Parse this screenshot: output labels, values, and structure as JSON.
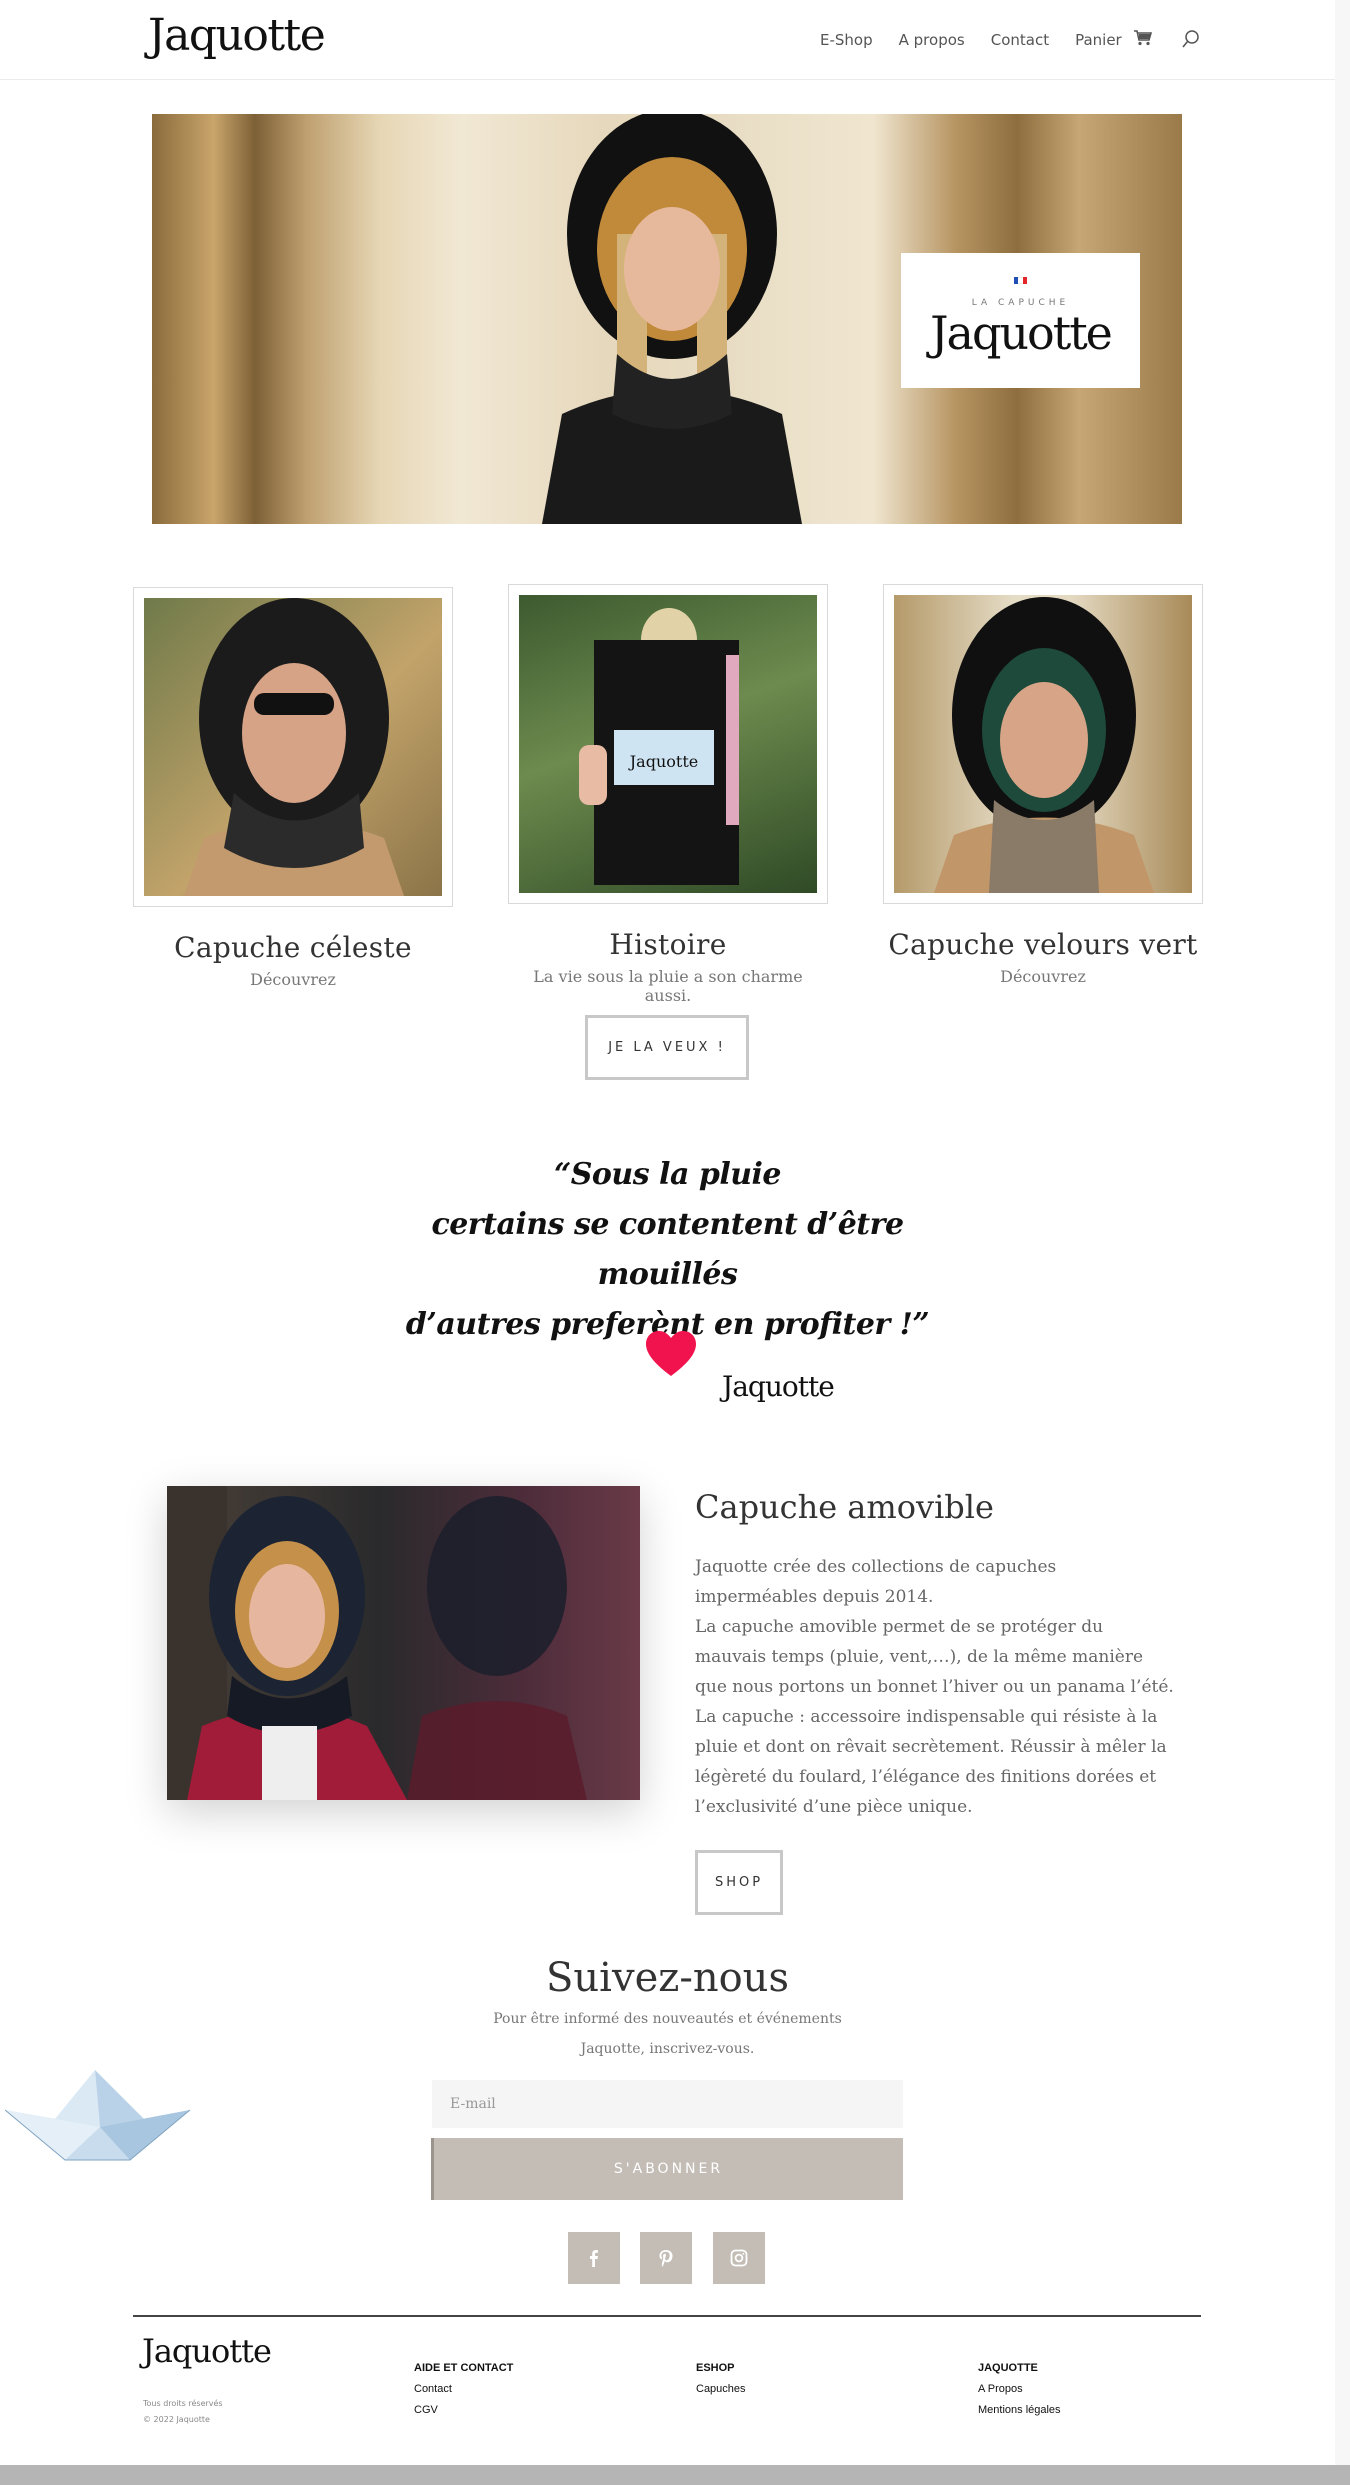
{
  "header": {
    "logo": "Jaquotte",
    "nav": [
      "E-Shop",
      "A propos",
      "Contact",
      "Panier"
    ]
  },
  "hero": {
    "badge_sub": "LA CAPUCHE",
    "badge_brand": "Jaquotte"
  },
  "cards": [
    {
      "title": "Capuche céleste",
      "subtitle": "Découvrez"
    },
    {
      "title": "Histoire",
      "subtitle": "La vie sous la pluie a son charme aussi."
    },
    {
      "title": "Capuche velours vert",
      "subtitle": "Découvrez"
    }
  ],
  "cta_button": "JE LA VEUX !",
  "quote": {
    "line1": "“Sous la pluie",
    "line2": "certains se contentent d’être mouillés",
    "line3": "d’autres preferènt en profiter !”",
    "signature": "Jaquotte"
  },
  "amovible": {
    "title": "Capuche amovible",
    "paragraph1": "Jaquotte crée des collections de capuches imperméables depuis 2014.",
    "paragraph2": "La capuche amovible permet de se protéger du mauvais temps (pluie, vent,…), de la même manière que nous portons un bonnet l’hiver ou un panama l’été. La capuche : accessoire indispensable qui résiste à la pluie et dont on rêvait secrètement. Réussir à mêler la légèreté du foulard, l’élégance des finitions dorées et l’exclusivité d’une pièce unique.",
    "button": "SHOP"
  },
  "subscribe": {
    "title": "Suivez-nous",
    "text": "Pour être informé des nouveautés et événements Jaquotte, inscrivez-vous.",
    "email_placeholder": "E-mail",
    "button": "S'ABONNER"
  },
  "social": [
    "facebook-icon",
    "pinterest-icon",
    "instagram-icon"
  ],
  "footer": {
    "logo": "Jaquotte",
    "rights": "Tous droits réservés",
    "copyright": "© 2022 Jaquotte",
    "columns": [
      {
        "heading": "AIDE ET CONTACT",
        "links": [
          "Contact",
          "CGV"
        ]
      },
      {
        "heading": "ESHOP",
        "links": [
          "Capuches"
        ]
      },
      {
        "heading": "JAQUOTTE",
        "links": [
          "A Propos",
          "Mentions légales"
        ]
      }
    ]
  },
  "colors": {
    "accent_gray": "#c3bdb6",
    "heart": "#f0134d",
    "text": "#666666",
    "heading": "#333333"
  }
}
